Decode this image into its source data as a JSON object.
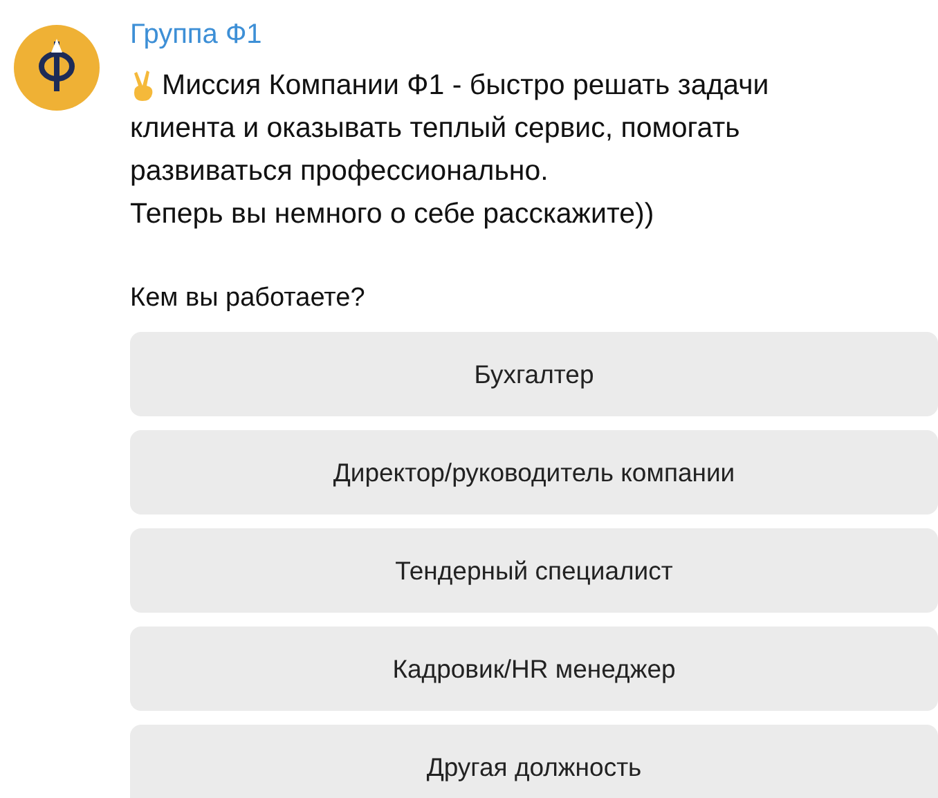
{
  "message": {
    "sender": "Группа Ф1",
    "lines": [
      "Миссия Компании Ф1 - быстро решать задачи",
      "клиента и оказывать теплый сервис, помогать",
      "развиваться профессионально.",
      "Теперь вы немного о себе расскажите))"
    ],
    "question": "Кем вы работаете?"
  },
  "buttons": [
    "Бухгалтер",
    "Директор/руководитель компании",
    "Тендерный специалист",
    "Кадровик/HR менеджер",
    "Другая должность"
  ]
}
